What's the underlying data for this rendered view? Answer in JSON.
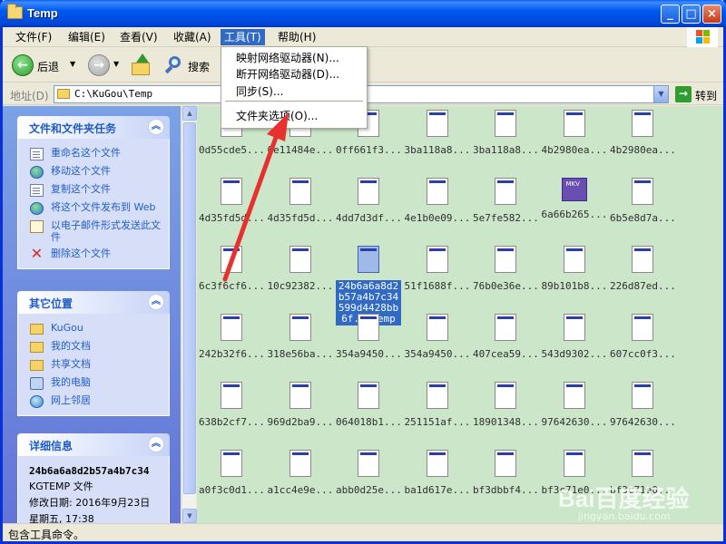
{
  "window": {
    "title": "Temp"
  },
  "menubar": {
    "items": [
      "文件(F)",
      "编辑(E)",
      "查看(V)",
      "收藏(A)",
      "工具(T)",
      "帮助(H)"
    ],
    "active": "工具(T)"
  },
  "toolbar": {
    "back_label": "后退",
    "search_label": "搜索"
  },
  "address": {
    "label": "地址(D)",
    "value": "C:\\KuGou\\Temp",
    "go_label": "转到"
  },
  "tools_menu": {
    "items": [
      "映射网络驱动器(N)...",
      "断开网络驱动器(D)...",
      "同步(S)...",
      "文件夹选项(O)..."
    ]
  },
  "left_pane": {
    "file_tasks": {
      "title": "文件和文件夹任务",
      "items": [
        "重命名这个文件",
        "移动这个文件",
        "复制这个文件",
        "将这个文件发布到 Web",
        "以电子邮件形式发送此文件",
        "删除这个文件"
      ]
    },
    "other_places": {
      "title": "其它位置",
      "items": [
        "KuGou",
        "我的文档",
        "共享文档",
        "我的电脑",
        "网上邻居"
      ]
    },
    "details": {
      "title": "详细信息",
      "name": "24b6a6a8d2b57a4b7c34",
      "type": "KGTEMP 文件",
      "modified": "修改日期: 2016年9月23日",
      "weekday": "星期五, 17:38"
    }
  },
  "files": [
    "0d55cde5...",
    "0e11484e...",
    "0ff661f3...",
    "3ba118a8...",
    "3ba118a8...",
    "4b2980ea...",
    "4b2980ea...",
    "4d35fd5d...",
    "4d35fd5d...",
    "4dd7d3df...",
    "4e1b0e09...",
    "5e7fe582...",
    "6a66b265...",
    "6b5e8d7a...",
    "6c3f6cf6...",
    "10c92382...",
    "24b6a6a8d2b57a4b7c34599d4428bb6f.kgtemp",
    "51f1688f...",
    "76b0e36e...",
    "89b101b8...",
    "226d87ed...",
    "242b32f6...",
    "318e56ba...",
    "354a9450...",
    "354a9450...",
    "407cea59...",
    "543d9302...",
    "607cc0f3...",
    "638b2cf7...",
    "969d2ba9...",
    "064018b1...",
    "251151af...",
    "18901348...",
    "97642630...",
    "97642630...",
    "a0f3c0d1...",
    "a1cc4e9e...",
    "abb0d25e...",
    "ba1d617e...",
    "bf3dbbf4...",
    "bf3c71e0...",
    "bf3c71e0..."
  ],
  "mkv_label": "MKV",
  "status": {
    "text": "包含工具命令。"
  },
  "watermark": {
    "logo": "Bai百度经验",
    "sub": "jingyan.baidu.com"
  },
  "colors": {
    "accent": "#316AC5",
    "content_bg": "#CBE6C9",
    "arrow": "#E8302F"
  }
}
